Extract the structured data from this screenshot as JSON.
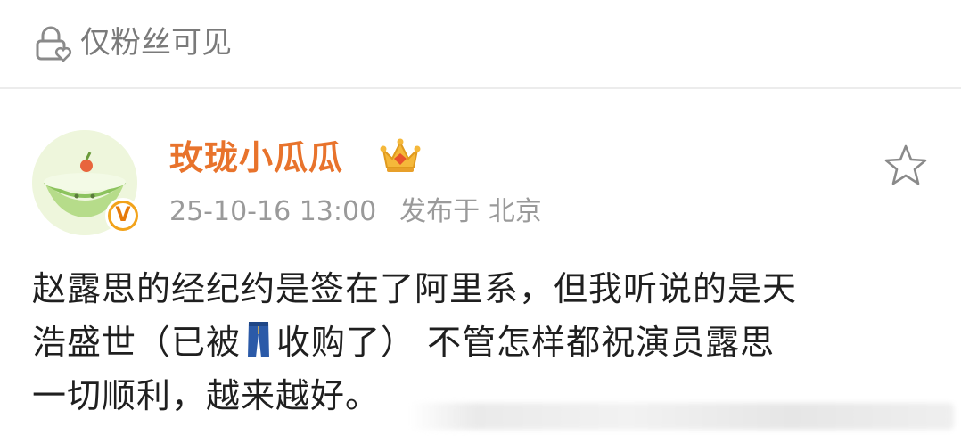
{
  "visibility": {
    "icon": "lock-heart-icon",
    "label": "仅粉丝可见"
  },
  "author": {
    "name": "玫珑小瓜瓜",
    "name_color": "#e8732c",
    "badge_icon": "vip-crown-icon",
    "verified_icon": "verified-v-icon",
    "verified_mark": "V"
  },
  "post": {
    "time": "25-10-16 13:00",
    "source": "发布于 北京",
    "body_lines": [
      "赵露思的经纪约是签在了阿里系，但我听说的是天",
      "浩盛世（已被",
      "收购了） 不管怎样都祝演员露思",
      "一切顺利，越来越好。"
    ],
    "inline_icon": "jeans-icon"
  },
  "actions": {
    "favorite_icon": "star-outline-icon"
  }
}
